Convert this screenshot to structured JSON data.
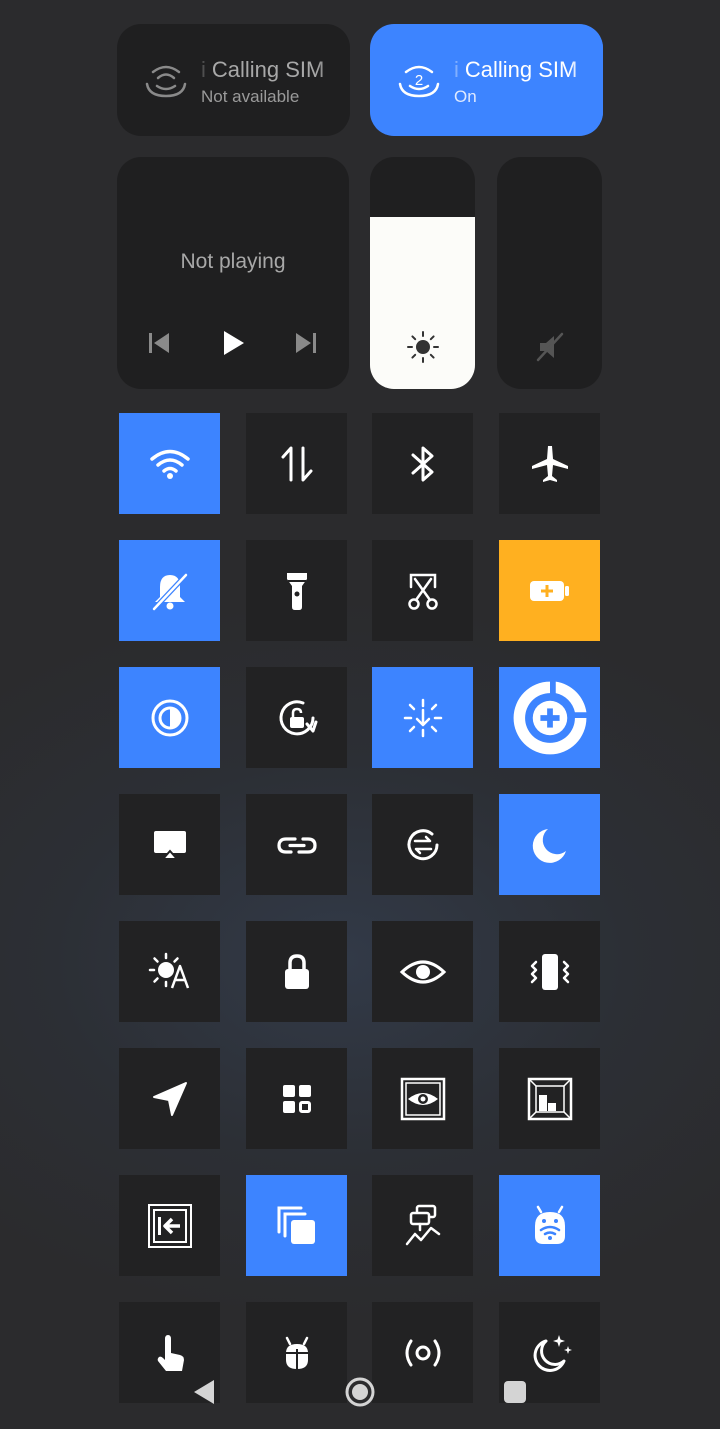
{
  "sim1": {
    "prefix": "i",
    "title": "Calling SIM",
    "status": "Not available",
    "icon": "sim-signal-icon"
  },
  "sim2": {
    "prefix": "i",
    "title": "Calling SIM",
    "status": "On",
    "icon": "sim-2-signal-icon"
  },
  "media": {
    "status": "Not playing"
  },
  "brightness": {
    "level_percent": 74,
    "icon": "sun-icon"
  },
  "volume": {
    "level_percent": 0,
    "icon": "volume-muted-icon"
  },
  "colors": {
    "accent": "#3d84ff",
    "warning": "#ffb020",
    "tile_off": "#222223"
  },
  "tiles": [
    {
      "icon": "wifi-icon",
      "active": true
    },
    {
      "icon": "mobile-data-icon",
      "active": false
    },
    {
      "icon": "bluetooth-icon",
      "active": false
    },
    {
      "icon": "airplane-icon",
      "active": false
    },
    {
      "icon": "mute-bell-icon",
      "active": true
    },
    {
      "icon": "flashlight-icon",
      "active": false
    },
    {
      "icon": "screenshot-scissors-icon",
      "active": false
    },
    {
      "icon": "battery-saver-icon",
      "active": true
    },
    {
      "icon": "invert-colors-icon",
      "active": true
    },
    {
      "icon": "rotation-lock-icon",
      "active": false
    },
    {
      "icon": "auto-brightness-icon",
      "active": true
    },
    {
      "icon": "app-shortcut-icon",
      "active": true
    },
    {
      "icon": "cast-icon",
      "active": false
    },
    {
      "icon": "link-icon",
      "active": false
    },
    {
      "icon": "sync-icon",
      "active": false
    },
    {
      "icon": "dark-mode-moon-icon",
      "active": true
    },
    {
      "icon": "adaptive-brightness-icon",
      "active": false
    },
    {
      "icon": "lock-icon",
      "active": false
    },
    {
      "icon": "eye-icon",
      "active": false
    },
    {
      "icon": "vibrate-icon",
      "active": false
    },
    {
      "icon": "location-icon",
      "active": false
    },
    {
      "icon": "apps-grid-icon",
      "active": false
    },
    {
      "icon": "screen-eye-icon",
      "active": false
    },
    {
      "icon": "window-layout-icon",
      "active": false
    },
    {
      "icon": "exit-frame-icon",
      "active": false
    },
    {
      "icon": "overlay-windows-icon",
      "active": true
    },
    {
      "icon": "performance-graph-icon",
      "active": false
    },
    {
      "icon": "android-wifi-icon",
      "active": true
    },
    {
      "icon": "touch-hand-icon",
      "active": false
    },
    {
      "icon": "bug-icon",
      "active": false
    },
    {
      "icon": "hotspot-icon",
      "active": false
    },
    {
      "icon": "night-sparkle-icon",
      "active": false
    }
  ],
  "nav": {
    "back": "back-icon",
    "home": "home-icon",
    "recents": "recents-icon"
  }
}
